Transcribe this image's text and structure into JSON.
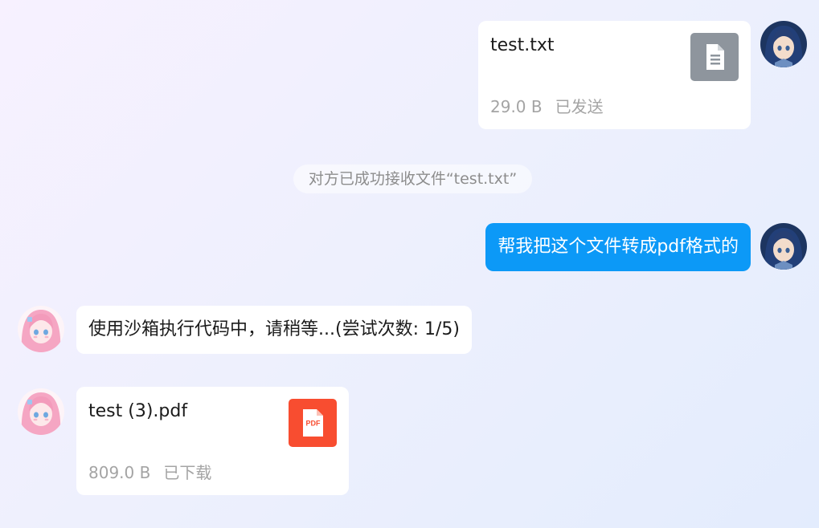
{
  "messages": {
    "file_sent": {
      "file_name": "test.txt",
      "file_size": "29.0 B",
      "status": "已发送",
      "icon": "text-file-icon",
      "icon_color": "#8e959d"
    },
    "system_notice": {
      "text": "对方已成功接收文件“test.txt”"
    },
    "user_text": {
      "text": "帮我把这个文件转成pdf格式的",
      "bubble_color": "#0c99f7"
    },
    "bot_text": {
      "text": "使用沙箱执行代码中，请稍等...(尝试次数: 1/5)"
    },
    "file_received": {
      "file_name": "test (3).pdf",
      "file_size": "809.0 B",
      "status": "已下载",
      "icon": "pdf-file-icon",
      "icon_label": "PDF",
      "icon_color": "#f84d30"
    }
  }
}
